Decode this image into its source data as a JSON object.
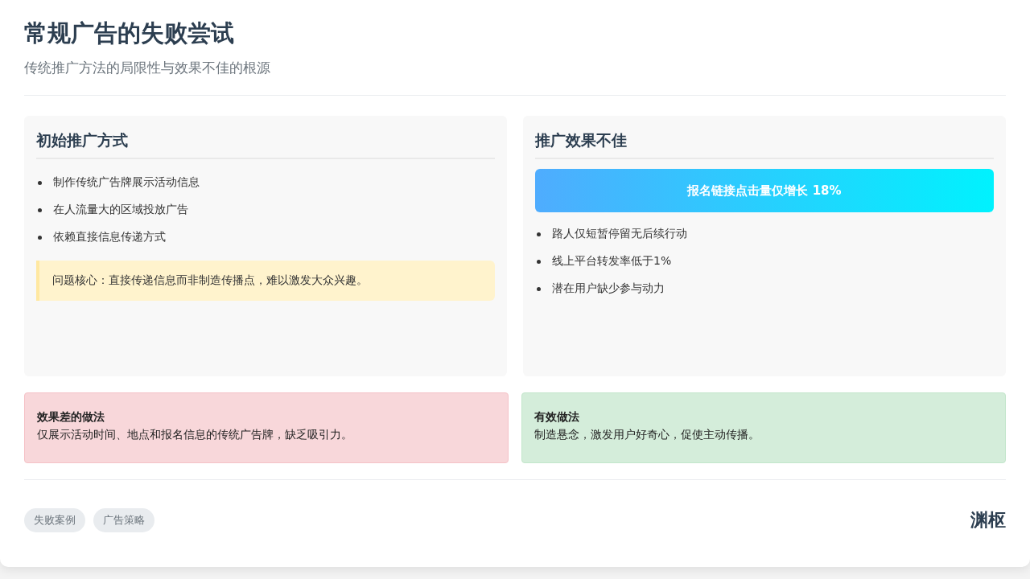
{
  "header": {
    "title": "常规广告的失败尝试",
    "subtitle": "传统推广方法的局限性与效果不佳的根源"
  },
  "panels": [
    {
      "title": "初始推广方式",
      "kind": "list-then-note",
      "items": [
        "制作传统广告牌展示活动信息",
        "在人流量大的区域投放广告",
        "依赖直接信息传递方式"
      ],
      "note": "问题核心：直接传递信息而非制造传播点，难以激发大众兴趣。"
    },
    {
      "title": "推广效果不佳",
      "kind": "highlight-then-list",
      "highlight": "报名链接点击量仅增长 18%",
      "items": [
        "路人仅短暂停留无后续行动",
        "线上平台转发率低于1%",
        "潜在用户缺少参与动力"
      ]
    }
  ],
  "comparison": [
    {
      "kind": "bad",
      "title": "效果差的做法",
      "text": "仅展示活动时间、地点和报名信息的传统广告牌，缺乏吸引力。"
    },
    {
      "kind": "good",
      "title": "有效做法",
      "text": "制造悬念，激发用户好奇心，促使主动传播。"
    }
  ],
  "footer": {
    "tags": [
      "失败案例",
      "广告策略"
    ],
    "logo": "渊枢"
  }
}
